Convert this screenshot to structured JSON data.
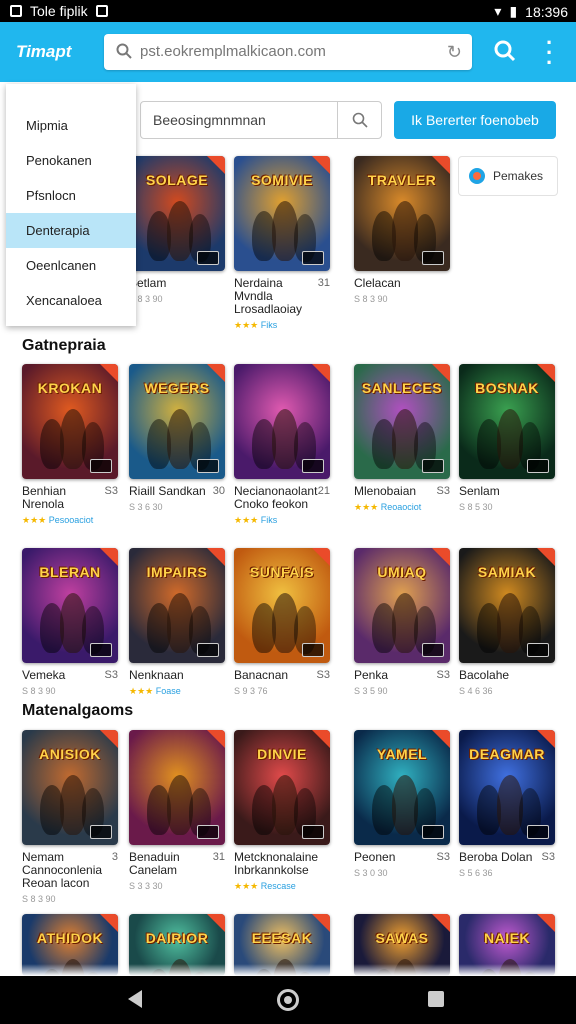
{
  "status_bar": {
    "left_text": "Tole fiplik",
    "time": "18:396"
  },
  "app_bar": {
    "brand": "Timapt",
    "url": "pst.eokremplmalkicaon.com"
  },
  "search": {
    "placeholder": "Beeosingmnmnan"
  },
  "action_button": {
    "label": "Ik Bererter foenobeb"
  },
  "chip": {
    "label": "Pemakes"
  },
  "drawer": {
    "items": [
      "Mipmia",
      "Penokanen",
      "Pfsnlocn",
      "Denterapia",
      "Oeenlcanen",
      "Xencanaloea"
    ],
    "active_index": 3
  },
  "colors": {
    "accent": "#20b7ee",
    "button": "#19a9e6",
    "drawer_active": "#b9e5f8"
  },
  "sections": [
    {
      "title": "Gatnepraia"
    },
    {
      "title": "Matenalgaoms"
    }
  ],
  "cards": [
    {
      "logo": "SOLAGE",
      "title": "Setlam",
      "count": "",
      "sub": "S 8 3 90",
      "rating": ""
    },
    {
      "logo": "SOMIVIE",
      "title": "Nerdaina Mvndla Lrosadlaoiay",
      "count": "31",
      "sub": "",
      "rating": "Fiks"
    },
    {
      "logo": "TRAVLER",
      "title": "Clelacan",
      "count": "",
      "sub": "S 8 3 90",
      "rating": ""
    },
    {
      "logo": "KROKAN",
      "title": "Benhian Nrenola",
      "count": "S3",
      "sub": "",
      "rating": "Pesooaciot"
    },
    {
      "logo": "WEGERS",
      "title": "Riaill Sandkan",
      "count": "30",
      "sub": "S 3 6 30",
      "rating": ""
    },
    {
      "logo": "",
      "title": "Necianonaolant Cnoko feokon",
      "count": "21",
      "sub": "",
      "rating": "Fiks"
    },
    {
      "logo": "SANLECES",
      "title": "Mlenobaian",
      "count": "S3",
      "sub": "",
      "rating": "Reoaociot"
    },
    {
      "logo": "BOSNAK",
      "title": "Senlam",
      "count": "",
      "sub": "S 8 5 30",
      "rating": ""
    },
    {
      "logo": "BLERAN",
      "title": "Vemeka",
      "count": "S3",
      "sub": "S 8 3 90",
      "rating": ""
    },
    {
      "logo": "IMPAIRS",
      "title": "Nenknaan",
      "count": "",
      "sub": "",
      "rating": "Foase"
    },
    {
      "logo": "SUNFAIS",
      "title": "Banacnan",
      "count": "S3",
      "sub": "S 9 3 76",
      "rating": ""
    },
    {
      "logo": "UMIAQ",
      "title": "Penka",
      "count": "S3",
      "sub": "S 3 5 90",
      "rating": ""
    },
    {
      "logo": "SAMIAK",
      "title": "Bacolahe",
      "count": "",
      "sub": "S 4 6 36",
      "rating": ""
    },
    {
      "logo": "ANISIOK",
      "title": "Nemam Cannoconlenia Reoan lacon",
      "count": "3",
      "sub": "S 8 3 90",
      "rating": ""
    },
    {
      "logo": "",
      "title": "Benaduin Canelam",
      "count": "31",
      "sub": "S 3 3 30",
      "rating": ""
    },
    {
      "logo": "DINVIE",
      "title": "Metcknonalaine Inbrkannkolse",
      "count": "",
      "sub": "",
      "rating": "Rescase"
    },
    {
      "logo": "YAMEL",
      "title": "Peonen",
      "count": "S3",
      "sub": "S 3 0 30",
      "rating": ""
    },
    {
      "logo": "DEAGMAR",
      "title": "Beroba Dolan",
      "count": "S3",
      "sub": "S 5 6 36",
      "rating": ""
    },
    {
      "logo": "ATHIDOK",
      "title": "",
      "count": "",
      "sub": "",
      "rating": ""
    },
    {
      "logo": "DAIRIOR",
      "title": "",
      "count": "",
      "sub": "",
      "rating": ""
    },
    {
      "logo": "EEESAK",
      "title": "",
      "count": "",
      "sub": "",
      "rating": ""
    },
    {
      "logo": "SAWAS",
      "title": "",
      "count": "",
      "sub": "",
      "rating": ""
    },
    {
      "logo": "NAIEK",
      "title": "",
      "count": "",
      "sub": "",
      "rating": ""
    }
  ]
}
